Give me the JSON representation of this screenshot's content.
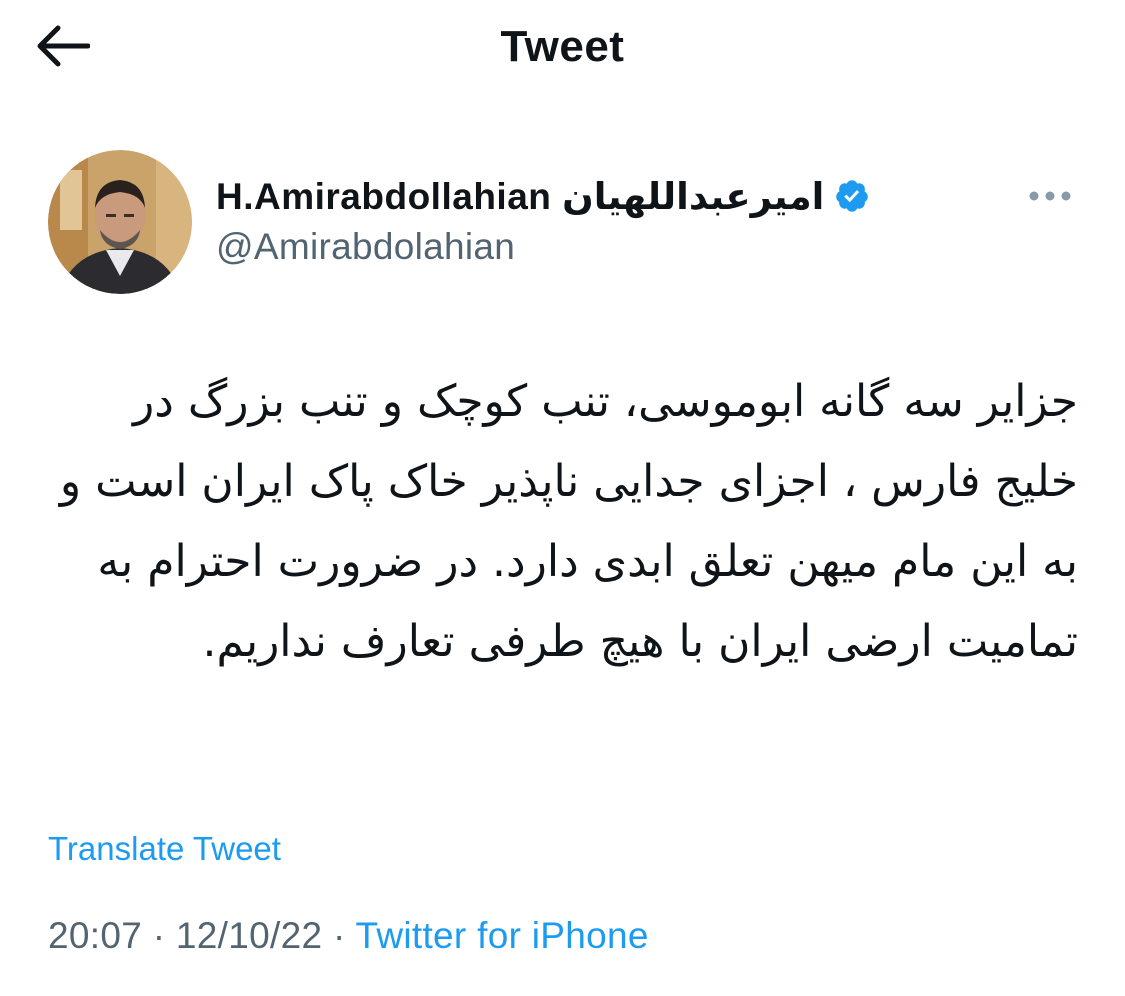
{
  "header": {
    "title": "Tweet",
    "back_icon": "arrow-left-icon"
  },
  "author": {
    "display_name": "H.Amirabdollahian امیرعبداللهیان",
    "handle": "@Amirabdolahian",
    "verified_icon": "verified-badge-icon",
    "verified_color": "#1d9bf0",
    "avatar_icon": "avatar-photo"
  },
  "more_icon": "more-horizontal-icon",
  "tweet": {
    "text": "جزایر سه گانه ابوموسی، تنب کوچک و تنب بزرگ در خلیج فارس ، اجزای جدایی ناپذیر خاک پاک ایران است و به این مام میهن تعلق ابدی دارد. در ضرورت احترام به تمامیت ارضی ایران با هیچ طرفی تعارف نداریم.",
    "translate_label": "Translate Tweet"
  },
  "meta": {
    "time": "20:07",
    "date": "12/10/22",
    "separator": "·",
    "source": "Twitter for iPhone"
  },
  "colors": {
    "accent": "#1d9bf0",
    "text": "#0f1419",
    "secondary": "#536471"
  }
}
